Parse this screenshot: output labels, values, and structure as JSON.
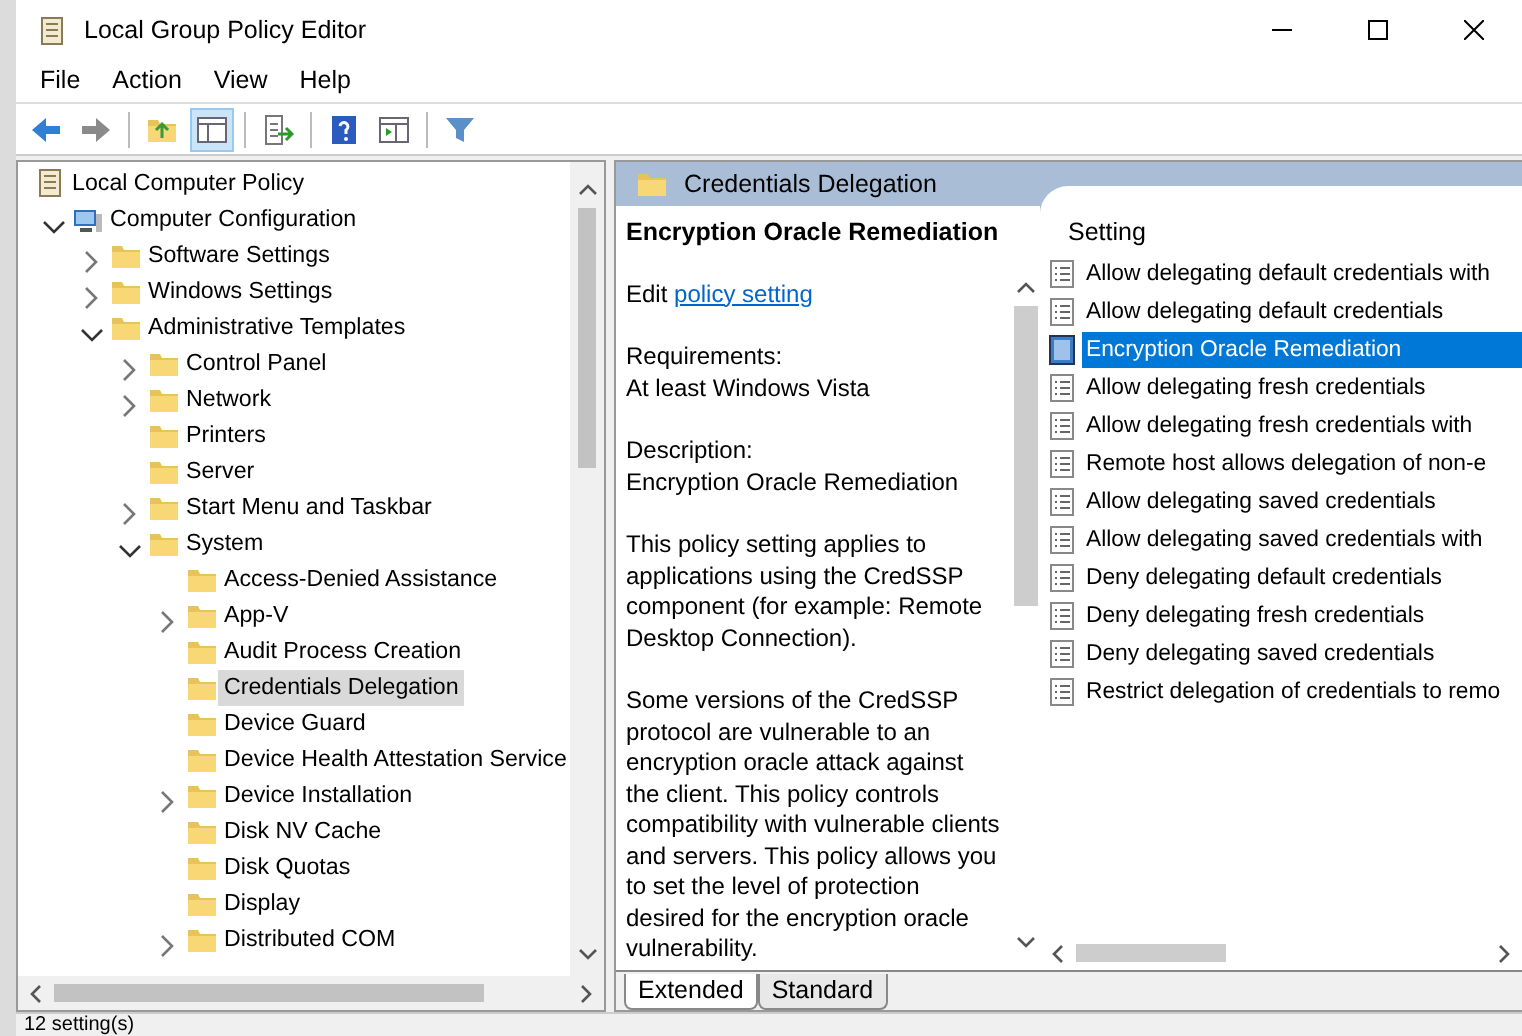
{
  "window": {
    "title": "Local Group Policy Editor"
  },
  "menu": [
    "File",
    "Action",
    "View",
    "Help"
  ],
  "toolbar": [
    [
      {
        "kind": "back",
        "pressed": false
      },
      {
        "kind": "forward",
        "pressed": false
      }
    ],
    [
      {
        "kind": "up",
        "pressed": false
      },
      {
        "kind": "tree",
        "pressed": true
      }
    ],
    [
      {
        "kind": "export",
        "pressed": false
      }
    ],
    [
      {
        "kind": "help",
        "pressed": false
      },
      {
        "kind": "view",
        "pressed": false
      }
    ],
    [
      {
        "kind": "filter",
        "pressed": false
      }
    ]
  ],
  "tree": [
    {
      "label": "Local Computer Policy",
      "kind": "policy",
      "selected": false,
      "children": [
        {
          "label": "Computer Configuration",
          "kind": "computer",
          "expanded": true,
          "selected": false,
          "children": [
            {
              "label": "Software Settings",
              "kind": "folder",
              "expanded": false,
              "selected": false
            },
            {
              "label": "Windows Settings",
              "kind": "folder",
              "expanded": false,
              "selected": false
            },
            {
              "label": "Administrative Templates",
              "kind": "folder",
              "expanded": true,
              "selected": false,
              "children": [
                {
                  "label": "Control Panel",
                  "kind": "folder",
                  "expanded": false,
                  "selected": false
                },
                {
                  "label": "Network",
                  "kind": "folder",
                  "expanded": false,
                  "selected": false
                },
                {
                  "label": "Printers",
                  "kind": "folder",
                  "selected": false
                },
                {
                  "label": "Server",
                  "kind": "folder",
                  "selected": false
                },
                {
                  "label": "Start Menu and Taskbar",
                  "kind": "folder",
                  "expanded": false,
                  "selected": false
                },
                {
                  "label": "System",
                  "kind": "folder",
                  "expanded": true,
                  "selected": false,
                  "children": [
                    {
                      "label": "Access-Denied Assistance",
                      "kind": "folder",
                      "selected": false
                    },
                    {
                      "label": "App-V",
                      "kind": "folder",
                      "expanded": false,
                      "selected": false
                    },
                    {
                      "label": "Audit Process Creation",
                      "kind": "folder",
                      "selected": false
                    },
                    {
                      "label": "Credentials Delegation",
                      "kind": "folder",
                      "selected": true
                    },
                    {
                      "label": "Device Guard",
                      "kind": "folder",
                      "selected": false
                    },
                    {
                      "label": "Device Health Attestation Service",
                      "kind": "folder",
                      "selected": false
                    },
                    {
                      "label": "Device Installation",
                      "kind": "folder",
                      "expanded": false,
                      "selected": false
                    },
                    {
                      "label": "Disk NV Cache",
                      "kind": "folder",
                      "selected": false
                    },
                    {
                      "label": "Disk Quotas",
                      "kind": "folder",
                      "selected": false
                    },
                    {
                      "label": "Display",
                      "kind": "folder",
                      "selected": false
                    },
                    {
                      "label": "Distributed COM",
                      "kind": "folder",
                      "expanded": false,
                      "selected": false
                    }
                  ]
                }
              ]
            }
          ]
        }
      ]
    }
  ],
  "details": {
    "header": "Credentials Delegation",
    "title": "Encryption Oracle Remediation",
    "edit_prefix": "Edit",
    "edit_link": "policy setting ",
    "requirements_label": "Requirements:",
    "requirements": "At least Windows Vista",
    "description_label": "Description:",
    "description": "Encryption Oracle Remediation",
    "paragraphs": [
      "This policy setting applies to applications using the CredSSP component (for example: Remote Desktop Connection).",
      "Some versions of the CredSSP protocol are vulnerable to an encryption oracle attack against the client.  This policy controls compatibility with vulnerable clients and servers.  This policy allows you to set the level of protection desired for the encryption oracle vulnerability."
    ]
  },
  "settings": {
    "column": "Setting",
    "items": [
      {
        "label": "Allow delegating default credentials with",
        "selected": false
      },
      {
        "label": "Allow delegating default credentials",
        "selected": false
      },
      {
        "label": "Encryption Oracle Remediation",
        "selected": true
      },
      {
        "label": "Allow delegating fresh credentials",
        "selected": false
      },
      {
        "label": "Allow delegating fresh credentials with",
        "selected": false
      },
      {
        "label": "Remote host allows delegation of non-e",
        "selected": false
      },
      {
        "label": "Allow delegating saved credentials",
        "selected": false
      },
      {
        "label": "Allow delegating saved credentials with",
        "selected": false
      },
      {
        "label": "Deny delegating default credentials",
        "selected": false
      },
      {
        "label": "Deny delegating fresh credentials",
        "selected": false
      },
      {
        "label": "Deny delegating saved credentials",
        "selected": false
      },
      {
        "label": "Restrict delegation of credentials to remo",
        "selected": false
      }
    ]
  },
  "view_tabs": [
    {
      "label": "Extended",
      "selected": true
    },
    {
      "label": "Standard",
      "selected": false
    }
  ],
  "status_bar": "12 setting(s)"
}
